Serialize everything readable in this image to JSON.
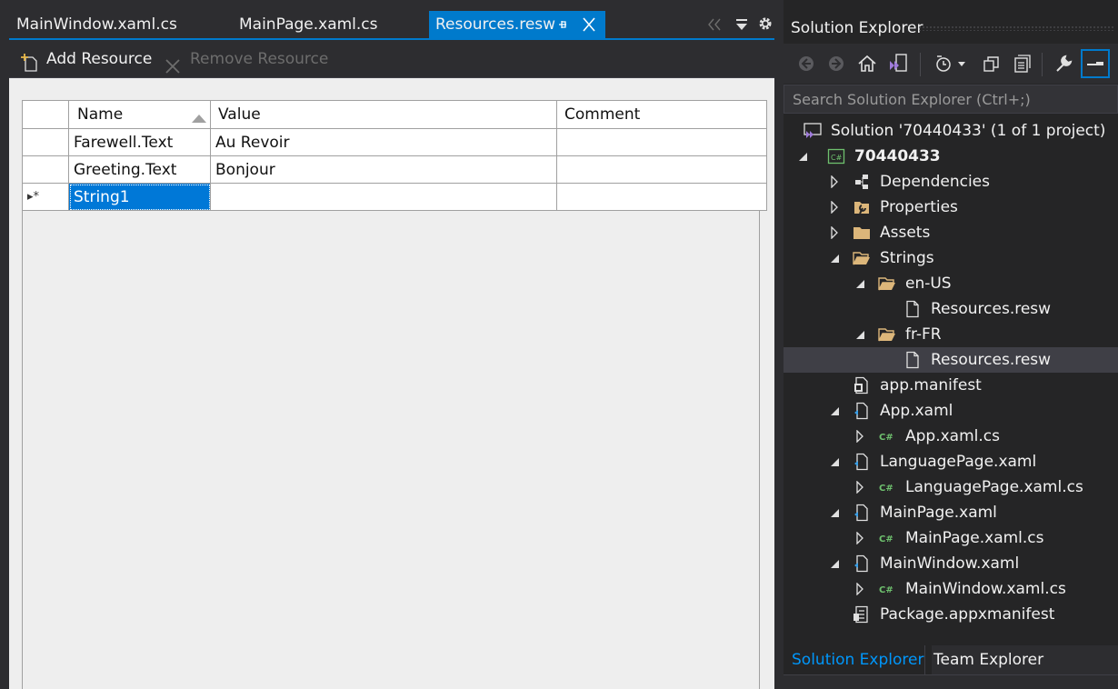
{
  "doc_tabs": [
    {
      "label": "MainWindow.xaml.cs"
    },
    {
      "label": "MainPage.xaml.cs"
    },
    {
      "label": "Resources.resw"
    }
  ],
  "toolbar": {
    "add_label": "Add Resource",
    "remove_label": "Remove Resource"
  },
  "grid": {
    "headers": {
      "name": "Name",
      "value": "Value",
      "comment": "Comment"
    },
    "rows": [
      {
        "name": "Farewell.Text",
        "value": "Au Revoir",
        "comment": ""
      },
      {
        "name": "Greeting.Text",
        "value": "Bonjour",
        "comment": ""
      },
      {
        "name": "String1",
        "value": "",
        "comment": "",
        "marker": "▸*"
      }
    ]
  },
  "solution_explorer": {
    "title": "Solution Explorer",
    "search_placeholder": "Search Solution Explorer (Ctrl+;)",
    "tree": [
      {
        "label": "Solution '70440433' (1 of 1 project)",
        "icon": "vs-solution-icon",
        "depth": 0,
        "expander": ""
      },
      {
        "label": "70440433",
        "icon": "csharp-project-icon",
        "depth": 0,
        "expander": "expanded",
        "bold": true
      },
      {
        "label": "Dependencies",
        "icon": "dependencies-icon",
        "depth": 1,
        "expander": "collapsed"
      },
      {
        "label": "Properties",
        "icon": "properties-icon",
        "depth": 1,
        "expander": "collapsed"
      },
      {
        "label": "Assets",
        "icon": "folder-icon",
        "depth": 1,
        "expander": "collapsed"
      },
      {
        "label": "Strings",
        "icon": "folder-open-icon",
        "depth": 1,
        "expander": "expanded"
      },
      {
        "label": "en-US",
        "icon": "folder-open-icon",
        "depth": 2,
        "expander": "expanded"
      },
      {
        "label": "Resources.resw",
        "icon": "file-icon",
        "depth": 3,
        "expander": ""
      },
      {
        "label": "fr-FR",
        "icon": "folder-open-icon",
        "depth": 2,
        "expander": "expanded"
      },
      {
        "label": "Resources.resw",
        "icon": "file-icon",
        "depth": 3,
        "expander": "",
        "selected": true
      },
      {
        "label": "app.manifest",
        "icon": "manifest-icon",
        "depth": 1,
        "expander": ""
      },
      {
        "label": "App.xaml",
        "icon": "xaml-file-icon",
        "depth": 1,
        "expander": "expanded"
      },
      {
        "label": "App.xaml.cs",
        "icon": "csharp-file-icon",
        "depth": 2,
        "expander": "collapsed"
      },
      {
        "label": "LanguagePage.xaml",
        "icon": "xaml-file-icon",
        "depth": 1,
        "expander": "expanded"
      },
      {
        "label": "LanguagePage.xaml.cs",
        "icon": "csharp-file-icon",
        "depth": 2,
        "expander": "collapsed"
      },
      {
        "label": "MainPage.xaml",
        "icon": "xaml-file-icon",
        "depth": 1,
        "expander": "expanded"
      },
      {
        "label": "MainPage.xaml.cs",
        "icon": "csharp-file-icon",
        "depth": 2,
        "expander": "collapsed"
      },
      {
        "label": "MainWindow.xaml",
        "icon": "xaml-file-icon",
        "depth": 1,
        "expander": "expanded"
      },
      {
        "label": "MainWindow.xaml.cs",
        "icon": "csharp-file-icon",
        "depth": 2,
        "expander": "collapsed"
      },
      {
        "label": "Package.appxmanifest",
        "icon": "package-manifest-icon",
        "depth": 1,
        "expander": ""
      }
    ],
    "bottom_tabs": [
      {
        "label": "Solution Explorer",
        "active": true
      },
      {
        "label": "Team Explorer",
        "active": false
      }
    ]
  },
  "colors": {
    "accent": "#007acc",
    "selection": "#0078d7",
    "folder": "#dcb67a",
    "csharp": "#6ec06e",
    "vs_purple": "#9f7bdb"
  }
}
